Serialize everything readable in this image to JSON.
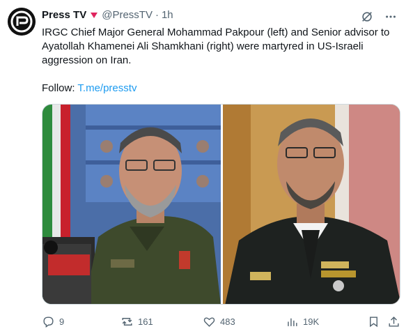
{
  "header": {
    "display_name": "Press TV",
    "handle": "@PressTV",
    "separator": "·",
    "time": "1h"
  },
  "tweet": {
    "text": "IRGC Chief Major General Mohammad Pakpour (left) and Senior advisor to\nAyatollah Khamenei Ali Shamkhani (right) were martyred in US-Israeli\naggression on Iran.",
    "follow_label": "Follow: ",
    "follow_link": "T.me/presstv"
  },
  "media": {
    "left_photo_icon": "man-in-green-uniform-photo",
    "right_photo_icon": "man-in-dark-uniform-photo"
  },
  "actions": {
    "replies": "9",
    "reposts": "161",
    "likes": "483",
    "views": "19K"
  },
  "colors": {
    "accent": "#1d9bf0",
    "muted": "#536471",
    "verified": "#e0245e"
  }
}
